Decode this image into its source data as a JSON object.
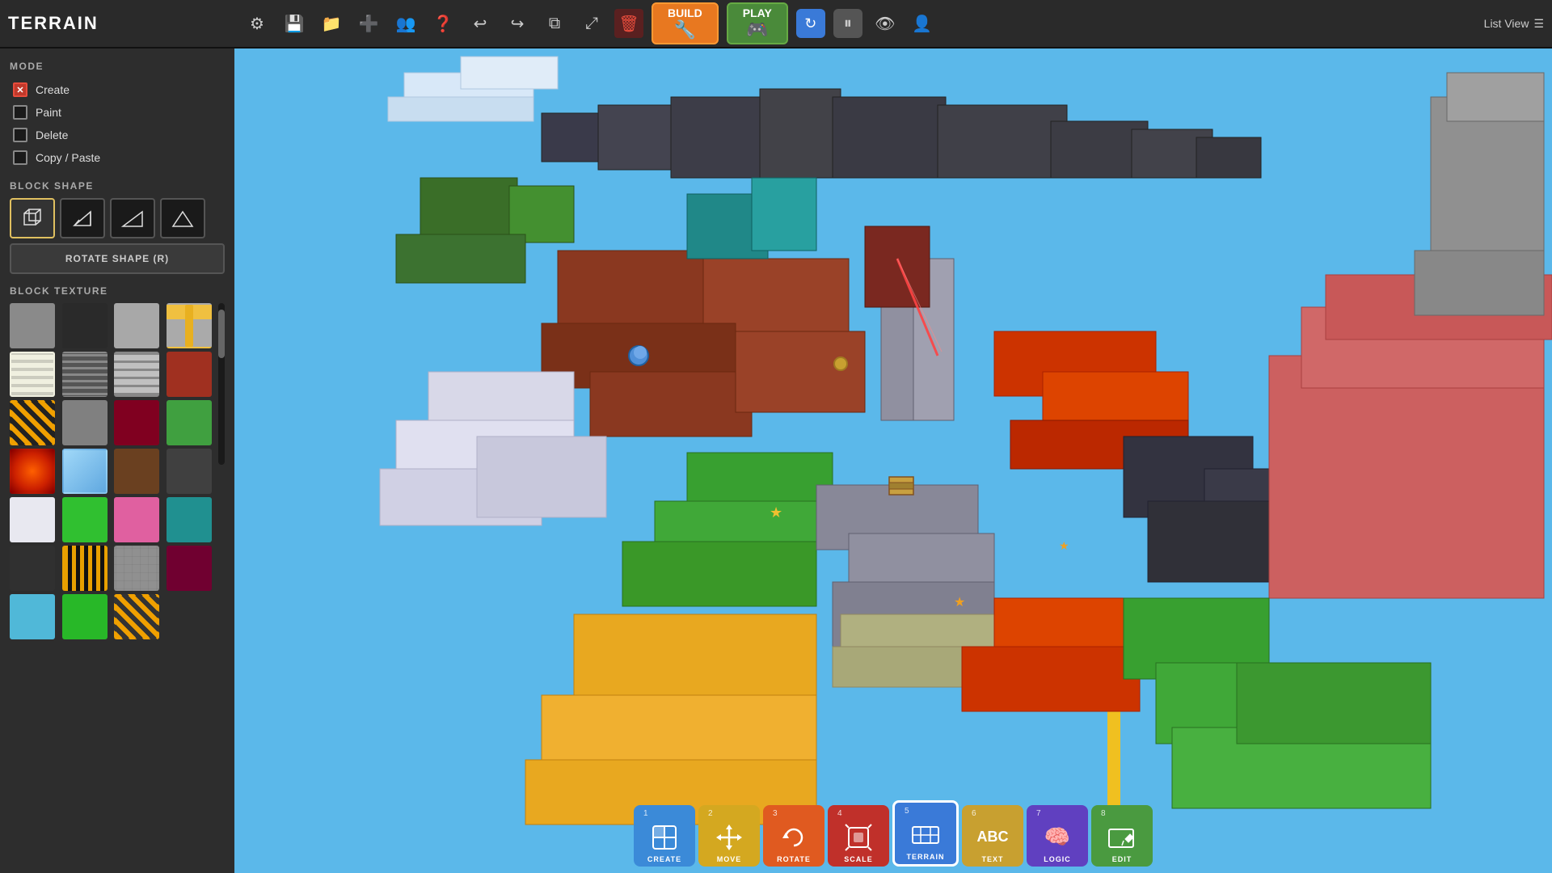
{
  "app": {
    "title": "TERRAIN"
  },
  "topbar": {
    "build_label": "BUILD",
    "play_label": "PLAY",
    "list_view_label": "List View"
  },
  "sidebar": {
    "mode_section": "MODE",
    "modes": [
      {
        "id": "create",
        "label": "Create",
        "active": true
      },
      {
        "id": "paint",
        "label": "Paint",
        "active": false
      },
      {
        "id": "delete",
        "label": "Delete",
        "active": false
      },
      {
        "id": "copy_paste",
        "label": "Copy / Paste",
        "active": false
      }
    ],
    "block_shape_section": "BLOCK SHAPE",
    "rotate_shape_label": "ROTATE SHAPE (R)",
    "block_texture_section": "BLOCK TEXTURE"
  },
  "bottom_tools": [
    {
      "number": "1",
      "label": "CREATE",
      "icon": "⊞",
      "class": "tool-create"
    },
    {
      "number": "2",
      "label": "MOVE",
      "icon": "✦",
      "class": "tool-move"
    },
    {
      "number": "3",
      "label": "ROTATE",
      "icon": "↺",
      "class": "tool-rotate"
    },
    {
      "number": "4",
      "label": "SCALE",
      "icon": "⛓",
      "class": "tool-scale"
    },
    {
      "number": "5",
      "label": "TERRAIN",
      "icon": "⊞",
      "class": "tool-terrain",
      "active": true
    },
    {
      "number": "6",
      "label": "TEXT",
      "icon": "ABC",
      "class": "tool-text"
    },
    {
      "number": "7",
      "label": "LOGIC",
      "icon": "🧠",
      "class": "tool-logic"
    },
    {
      "number": "8",
      "label": "EDIT",
      "icon": "✎",
      "class": "tool-edit"
    }
  ],
  "textures": [
    "tc-gray",
    "tc-dark",
    "tc-light-gray",
    "tc-yellow-v",
    "tc-cream-v",
    "tc-h-lines",
    "tc-v-lines",
    "tc-red-brick",
    "tc-moss",
    "tc-warning",
    "tc-cobble",
    "tc-dark-red",
    "tc-green",
    "tc-lava",
    "tc-ice",
    "tc-mud",
    "tc-dark-stone",
    "tc-snow",
    "tc-bright-green",
    "tc-pink",
    "tc-teal",
    "tc-hazard",
    "tc-stone-tile",
    "tc-maroon",
    "tc-cyan",
    "tc-bright-green2",
    "tc-hazard2"
  ]
}
